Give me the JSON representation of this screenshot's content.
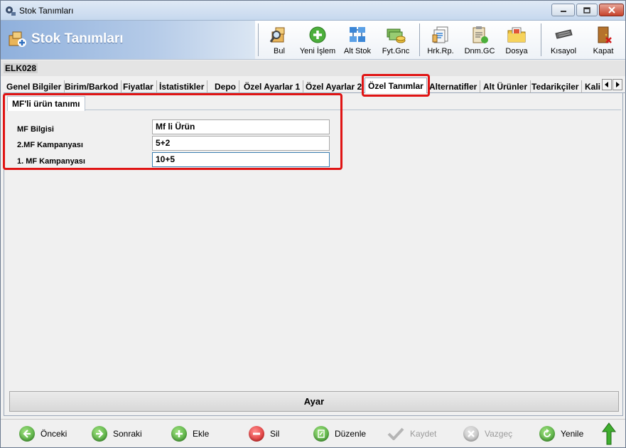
{
  "window": {
    "title": "Stok Tanımları",
    "controls": [
      "minimize-icon",
      "maximize-icon",
      "close-icon"
    ]
  },
  "header": {
    "title": "Stok Tanımları",
    "toolbar": [
      {
        "id": "bul",
        "label": "Bul",
        "icon": "search-boxes-icon"
      },
      {
        "id": "yeni-islem",
        "label": "Yeni İşlem",
        "icon": "add-green-icon"
      },
      {
        "id": "alt-stok",
        "label": "Alt Stok",
        "icon": "hierarchy-icon"
      },
      {
        "id": "fyt-gnc",
        "label": "Fyt.Gnc",
        "icon": "money-icon"
      },
      {
        "id": "hrk-rp",
        "label": "Hrk.Rp.",
        "icon": "report-icon"
      },
      {
        "id": "dnm-gc",
        "label": "Dnm.GC",
        "icon": "clipboard-icon"
      },
      {
        "id": "dosya",
        "label": "Dosya",
        "icon": "folder-images-icon"
      },
      {
        "id": "kisayol",
        "label": "Kısayol",
        "icon": "keyboard-icon"
      },
      {
        "id": "kapat",
        "label": "Kapat",
        "icon": "exit-door-icon"
      }
    ]
  },
  "record_code": "ELK028",
  "tabs": [
    {
      "label": "Genel Bilgiler",
      "active": false
    },
    {
      "label": "Birim/Barkod",
      "active": false
    },
    {
      "label": "Fiyatlar",
      "active": false
    },
    {
      "label": "İstatistikler",
      "active": false
    },
    {
      "label": "Depo",
      "active": false
    },
    {
      "label": "Özel Ayarlar 1",
      "active": false
    },
    {
      "label": "Özel Ayarlar 2",
      "active": false
    },
    {
      "label": "Özel Tanımlar",
      "active": true
    },
    {
      "label": "Alternatifler",
      "active": false
    },
    {
      "label": "Alt Ürünler",
      "active": false
    },
    {
      "label": "Tedarikçiler",
      "active": false
    },
    {
      "label": "Kali",
      "active": false
    }
  ],
  "subtab": {
    "label": "MF'li ürün tanımı"
  },
  "form": {
    "fields": [
      {
        "label": "MF Bilgisi",
        "value": "Mf li Ürün"
      },
      {
        "label": "2.MF Kampanyası",
        "value": "5+2"
      },
      {
        "label": "1. MF Kampanyası",
        "value": "10+5"
      }
    ]
  },
  "ayar_button": "Ayar",
  "actions": [
    {
      "label": "Önceki",
      "icon": "arrow-left-icon",
      "enabled": true
    },
    {
      "label": "Sonraki",
      "icon": "arrow-right-icon",
      "enabled": true
    },
    {
      "label": "Ekle",
      "icon": "plus-icon",
      "enabled": true
    },
    {
      "label": "Sil",
      "icon": "minus-icon",
      "enabled": true
    },
    {
      "label": "Düzenle",
      "icon": "edit-icon",
      "enabled": true
    },
    {
      "label": "Kaydet",
      "icon": "check-icon",
      "enabled": false
    },
    {
      "label": "Vazgeç",
      "icon": "cancel-icon",
      "enabled": false
    },
    {
      "label": "Yenile",
      "icon": "refresh-icon",
      "enabled": true
    }
  ],
  "colors": {
    "highlight": "#e01414",
    "banner": "#8fb0dc",
    "green": "#3a9a2a",
    "red": "#d21919"
  }
}
